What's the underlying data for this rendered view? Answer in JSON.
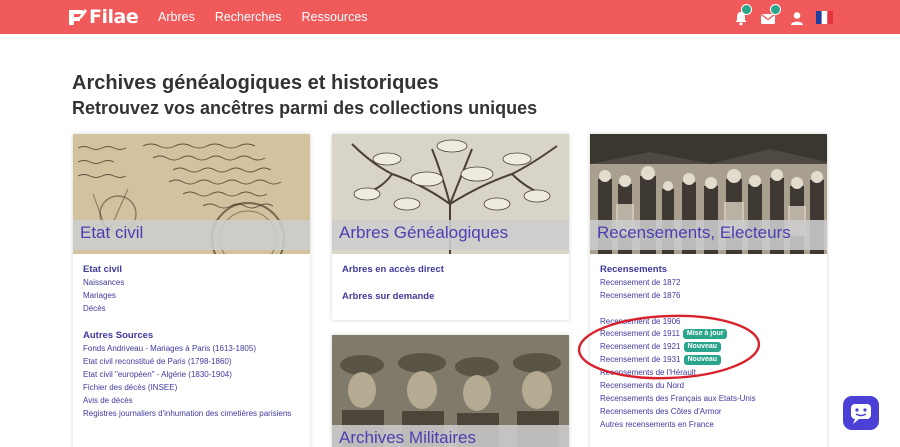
{
  "brand": {
    "name": "Filae",
    "color": "#f05a5b",
    "link_color": "#3f3a9e",
    "caption_color": "#4a3fb3",
    "badge_color": "#2aa58c"
  },
  "nav": {
    "links": [
      "Arbres",
      "Recherches",
      "Ressources"
    ],
    "icons": [
      "bell-icon",
      "mail-icon",
      "user-icon",
      "french-flag-icon"
    ]
  },
  "header": {
    "title": "Archives généalogiques et historiques",
    "subtitle": "Retrouvez vos ancêtres parmi des collections uniques"
  },
  "cards": {
    "etat_civil": {
      "caption": "Etat civil",
      "section1": {
        "title": "Etat civil",
        "links": [
          "Naissances",
          "Mariages",
          "Décès"
        ]
      },
      "section2": {
        "title": "Autres Sources",
        "links": [
          "Fonds Andriveau - Mariages à Paris (1613-1805)",
          "Etat civil reconstitué de Paris (1798-1860)",
          "Etat civil \"européen\" - Algérie (1830-1904)",
          "Fichier des décès (INSEE)",
          "Avis de décès",
          "Registres journaliers d'inhumation des cimetières parisiens"
        ]
      }
    },
    "arbres": {
      "caption": "Arbres Généalogiques",
      "links": [
        "Arbres en accès direct",
        "Arbres sur demande"
      ]
    },
    "militaires": {
      "caption": "Archives Militaires"
    },
    "recensements": {
      "caption": "Recensements, Electeurs",
      "section_title": "Recensements",
      "links": [
        "Recensement de 1872",
        "Recensement de 1876",
        "Recensement de 1906",
        "Recensement de 1911",
        "Recensement de 1921",
        "Recensement de 1931",
        "Recensements de l'Hérault",
        "Recensements du Nord",
        "Recensements des Français aux Etats-Unis",
        "Recensements des Côtes d'Armor",
        "Autres recensements en France"
      ],
      "badges": {
        "mise_a_jour": "Mise à jour",
        "nouveau": "Nouveau"
      }
    }
  }
}
